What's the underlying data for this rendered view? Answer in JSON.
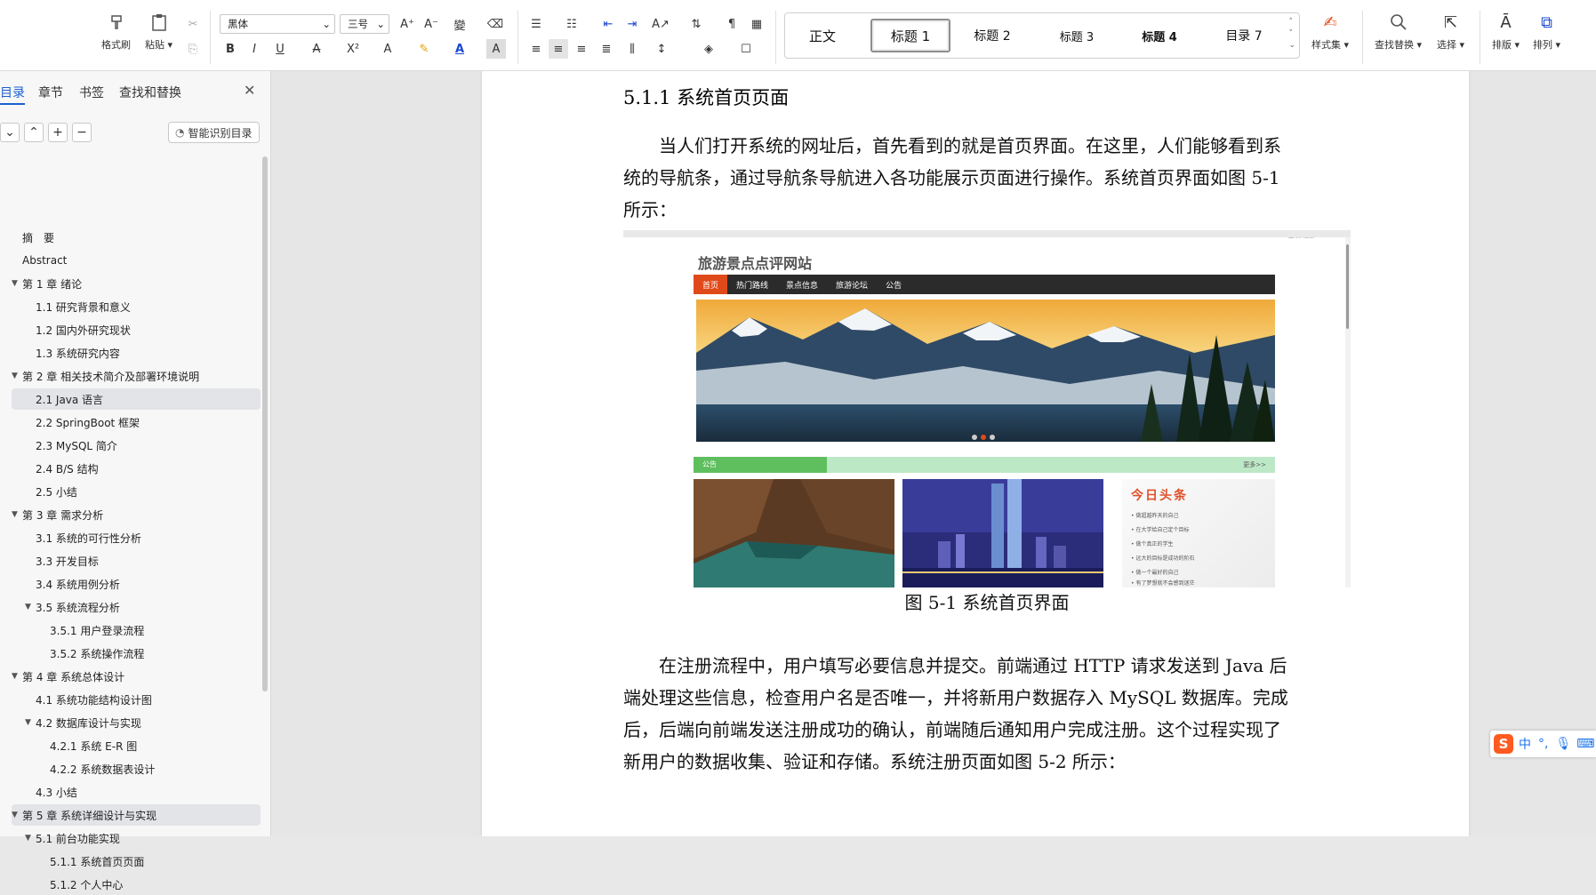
{
  "ribbon": {
    "format_painter": "格式刷",
    "paste": "粘贴",
    "font_name": "黑体",
    "font_size": "三号",
    "styles": [
      "正文",
      "标题 1",
      "标题 2",
      "标题 3",
      "标题 4",
      "目录 7"
    ],
    "style_set": "样式集",
    "find_replace": "查找替换",
    "select": "选择",
    "layout": "排版",
    "arrange": "排列"
  },
  "nav": {
    "tabs": [
      "目录",
      "章节",
      "书签",
      "查找和替换"
    ],
    "smart_toc": "智能识别目录",
    "toc": [
      {
        "label": "摘　要",
        "level": 1
      },
      {
        "label": "Abstract",
        "level": 1
      },
      {
        "label": "第 1 章  绪论",
        "level": 1,
        "caret": true
      },
      {
        "label": "1.1 研究背景和意义",
        "level": 2
      },
      {
        "label": "1.2 国内外研究现状",
        "level": 2
      },
      {
        "label": "1.3 系统研究内容",
        "level": 2
      },
      {
        "label": "第 2 章  相关技术简介及部署环境说明",
        "level": 1,
        "caret": true
      },
      {
        "label": "2.1 Java 语言",
        "level": 2,
        "highlight": true
      },
      {
        "label": "2.2 SpringBoot 框架",
        "level": 2
      },
      {
        "label": "2.3 MySQL 简介",
        "level": 2
      },
      {
        "label": "2.4 B/S 结构",
        "level": 2
      },
      {
        "label": "2.5 小结",
        "level": 2
      },
      {
        "label": "第 3 章  需求分析",
        "level": 1,
        "caret": true
      },
      {
        "label": "3.1 系统的可行性分析",
        "level": 2
      },
      {
        "label": "3.3 开发目标",
        "level": 2
      },
      {
        "label": "3.4  系统用例分析",
        "level": 2
      },
      {
        "label": "3.5 系统流程分析",
        "level": 2,
        "caret": true
      },
      {
        "label": "3.5.1  用户登录流程",
        "level": 3
      },
      {
        "label": "3.5.2  系统操作流程",
        "level": 3
      },
      {
        "label": "第 4 章  系统总体设计",
        "level": 1,
        "caret": true
      },
      {
        "label": "4.1 系统功能结构设计图",
        "level": 2
      },
      {
        "label": "4.2  数据库设计与实现",
        "level": 2,
        "caret": true
      },
      {
        "label": "4.2.1  系统 E-R 图",
        "level": 3
      },
      {
        "label": "4.2.2  系统数据表设计",
        "level": 3
      },
      {
        "label": "4.3 小结",
        "level": 2
      },
      {
        "label": "第 5 章  系统详细设计与实现",
        "level": 1,
        "caret": true,
        "highlight": true
      },
      {
        "label": "5.1 前台功能实现",
        "level": 2,
        "caret": true
      },
      {
        "label": "5.1.1  系统首页页面",
        "level": 3
      },
      {
        "label": "5.1.2 个人中心",
        "level": 3
      }
    ]
  },
  "doc": {
    "heading": "5.1.1 系统首页页面",
    "para1": [
      "　　当人们打开系统的网址后，首先看到的就是首页界面。在这里，人们能够看到系",
      "统的导航条，通过导航条导航进入各功能展示页面进行操作。系统首页界面如图 5-1",
      "所示："
    ],
    "figure": {
      "site_title": "旅游景点点评网站",
      "login_link": "登录/注册",
      "nav": [
        "首页",
        "热门路线",
        "景点信息",
        "旅游论坛",
        "公告"
      ],
      "notice_label": "公告",
      "notice_more": "更多>>",
      "headline_title": "今日头条",
      "headline_items": [
        "• 做超越昨天的自己",
        "• 在大学给自己定个目标",
        "• 做个真正的学生",
        "• 远大的目标是成功的阶石",
        "• 做一个最好的自己",
        "• 有了梦想就不会感到迷茫"
      ]
    },
    "caption": "图 5-1  系统首页界面",
    "para2": [
      "　　在注册流程中，用户填写必要信息并提交。前端通过 HTTP 请求发送到 Java 后",
      "端处理这些信息，检查用户名是否唯一，并将新用户数据存入 MySQL 数据库。完成",
      "后，后端向前端发送注册成功的确认，前端随后通知用户完成注册。这个过程实现了",
      "新用户的数据收集、验证和存储。系统注册页面如图 5-2 所示："
    ]
  },
  "ime": {
    "lang": "中",
    "punct": "°,"
  },
  "colors": {
    "nav_active": "#e04a1a",
    "notice_green": "#5fbf5f",
    "headline_red": "#e0502a",
    "toc_highlight": "#e2e4e7"
  }
}
